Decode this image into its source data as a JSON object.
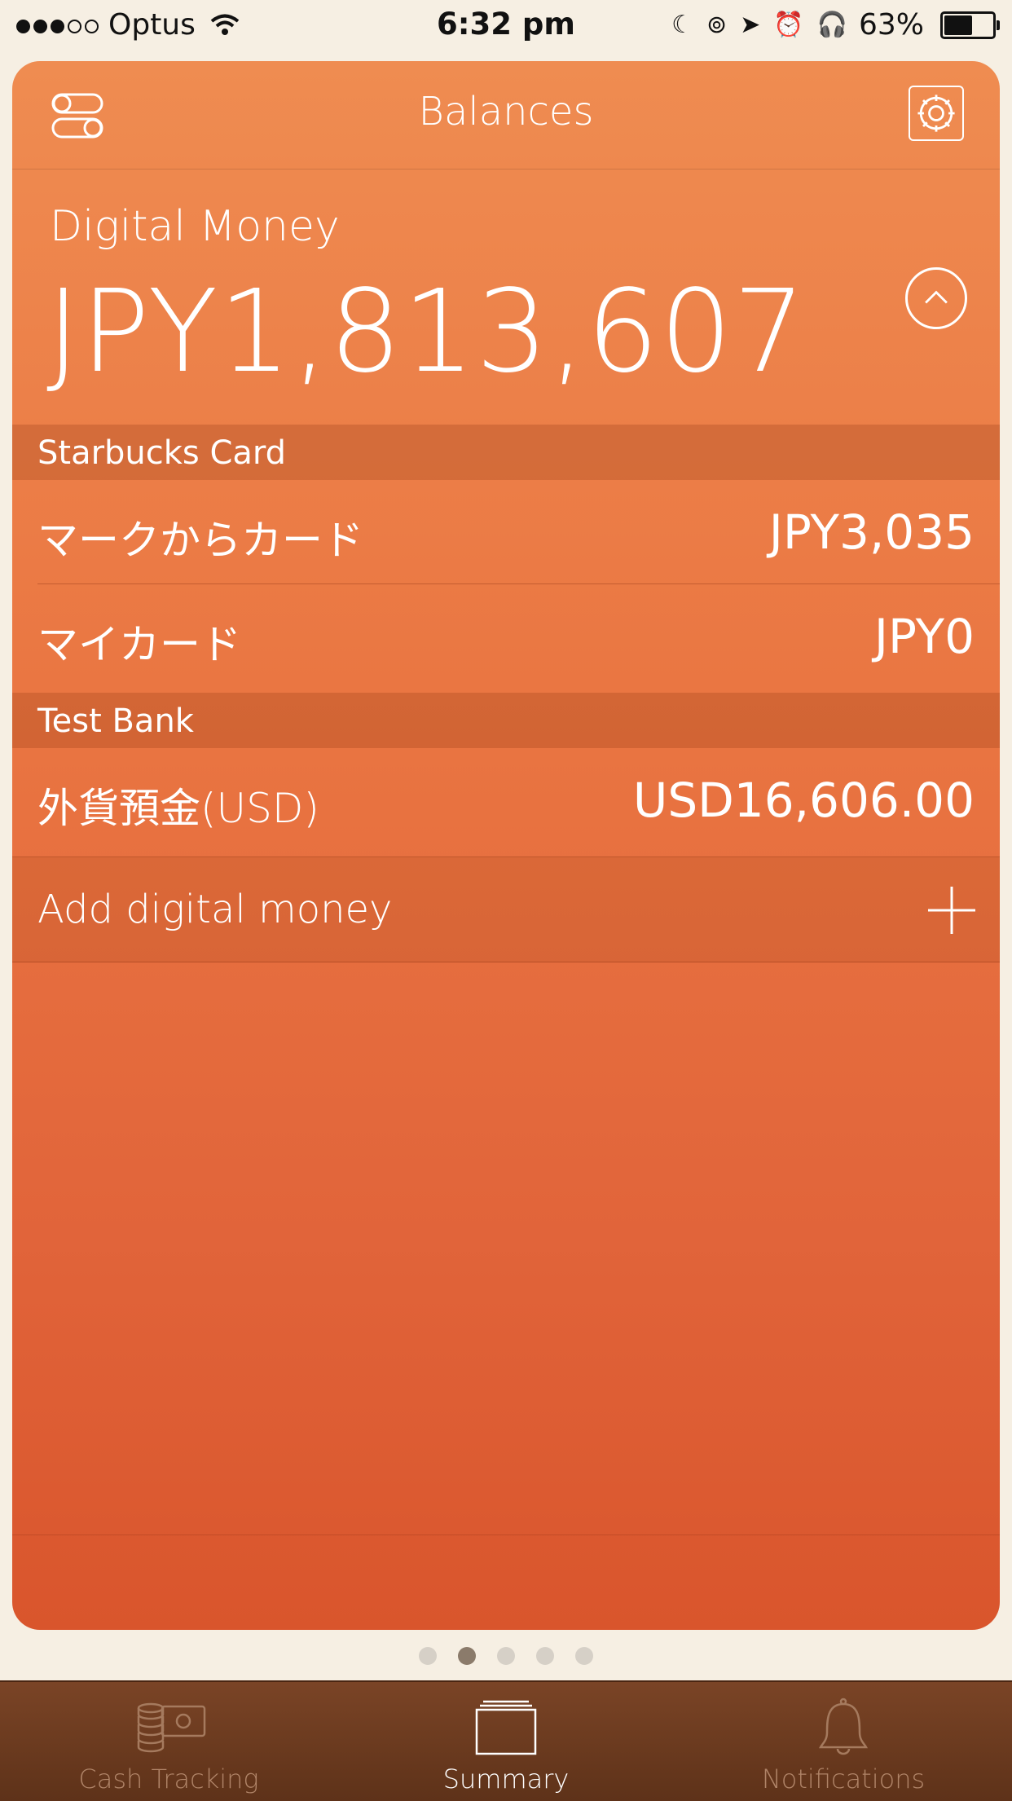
{
  "status_bar": {
    "carrier": "Optus",
    "signal_bars_filled": 3,
    "signal_bars_total": 5,
    "time": "6:32 pm",
    "battery_percent": "63%",
    "battery_level": 0.63,
    "icons": [
      "moon-icon",
      "rotation-lock-icon",
      "location-icon",
      "alarm-icon",
      "headphones-icon"
    ]
  },
  "header": {
    "title": "Balances"
  },
  "summary": {
    "label": "Digital Money",
    "total": "JPY1,813,607"
  },
  "groups": [
    {
      "name": "Starbucks Card",
      "items": [
        {
          "name": "マークからカード",
          "value": "JPY3,035"
        },
        {
          "name": "マイカード",
          "value": "JPY0"
        }
      ]
    },
    {
      "name": "Test Bank",
      "items": [
        {
          "name": "外貨預金(USD)",
          "value": "USD16,606.00"
        }
      ]
    }
  ],
  "add_action": {
    "label": "Add digital money"
  },
  "pager": {
    "count": 5,
    "active_index": 1
  },
  "tabs": [
    {
      "label": "Cash Tracking",
      "icon": "cash-icon",
      "active": false
    },
    {
      "label": "Summary",
      "icon": "cards-icon",
      "active": true
    },
    {
      "label": "Notifications",
      "icon": "bell-icon",
      "active": false
    }
  ],
  "colors": {
    "card_top": "#ef8c51",
    "card_bottom": "#d9552c",
    "background": "#f6efe3",
    "tabbar": "#6b391e"
  }
}
